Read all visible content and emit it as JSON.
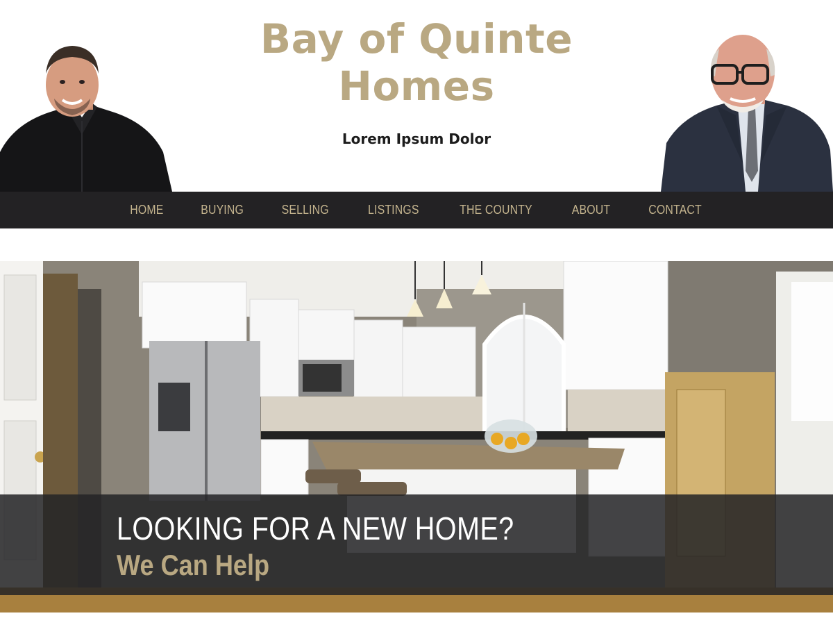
{
  "header": {
    "title_line1": "Bay of Quinte",
    "title_line2": "Homes",
    "tagline": "Lorem Ipsum Dolor"
  },
  "nav": {
    "items": [
      "HOME",
      "BUYING",
      "SELLING",
      "LISTINGS",
      "THE COUNTY",
      "ABOUT",
      "CONTACT"
    ]
  },
  "hero": {
    "headline": "LOOKING FOR A NEW HOME?",
    "subheadline": "We Can Help"
  },
  "colors": {
    "brand_gold": "#b9a882",
    "nav_background": "#232224",
    "nav_text": "#c4b48e",
    "banner_overlay": "#242426"
  },
  "images": {
    "left_agent": "photo-of-agent-black-shirt",
    "right_agent": "photo-of-agent-suit-glasses",
    "hero": "photo-of-kitchen-interior"
  }
}
